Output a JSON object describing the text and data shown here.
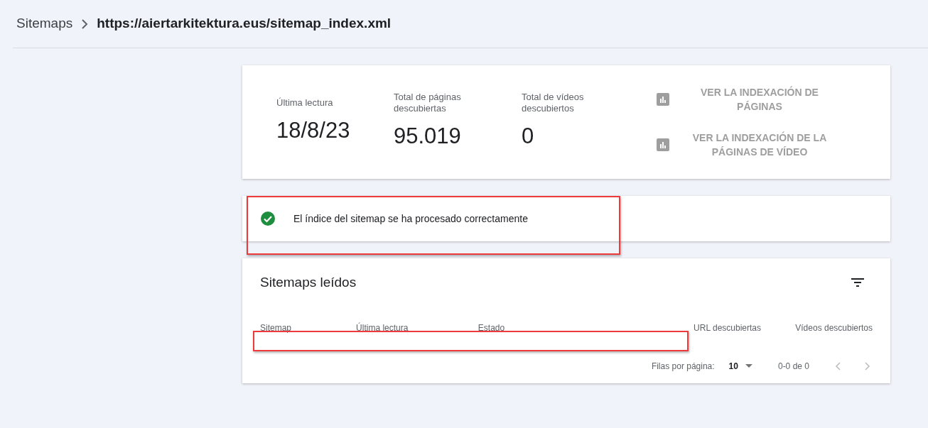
{
  "breadcrumb": {
    "parent": "Sitemaps",
    "current": "https://aiertarkitektura.eus/sitemap_index.xml"
  },
  "stats": [
    {
      "label": "Última lectura",
      "value": "18/8/23"
    },
    {
      "label": "Total de páginas descubiertas",
      "value": "95.019"
    },
    {
      "label": "Total de vídeos descubiertos",
      "value": "0"
    }
  ],
  "links": [
    "VER LA INDEXACIÓN DE PÁGINAS",
    "VER LA INDEXACIÓN DE LA PÁGINAS DE VÍDEO"
  ],
  "status": {
    "message": "El índice del sitemap se ha procesado correctamente"
  },
  "table": {
    "title": "Sitemaps leídos",
    "columns": [
      "Sitemap",
      "Última lectura",
      "Estado",
      "URL descubiertas",
      "Vídeos descubiertos"
    ],
    "pagination": {
      "rows_label": "Filas por página:",
      "rows_value": "10",
      "range": "0-0 de 0"
    }
  }
}
